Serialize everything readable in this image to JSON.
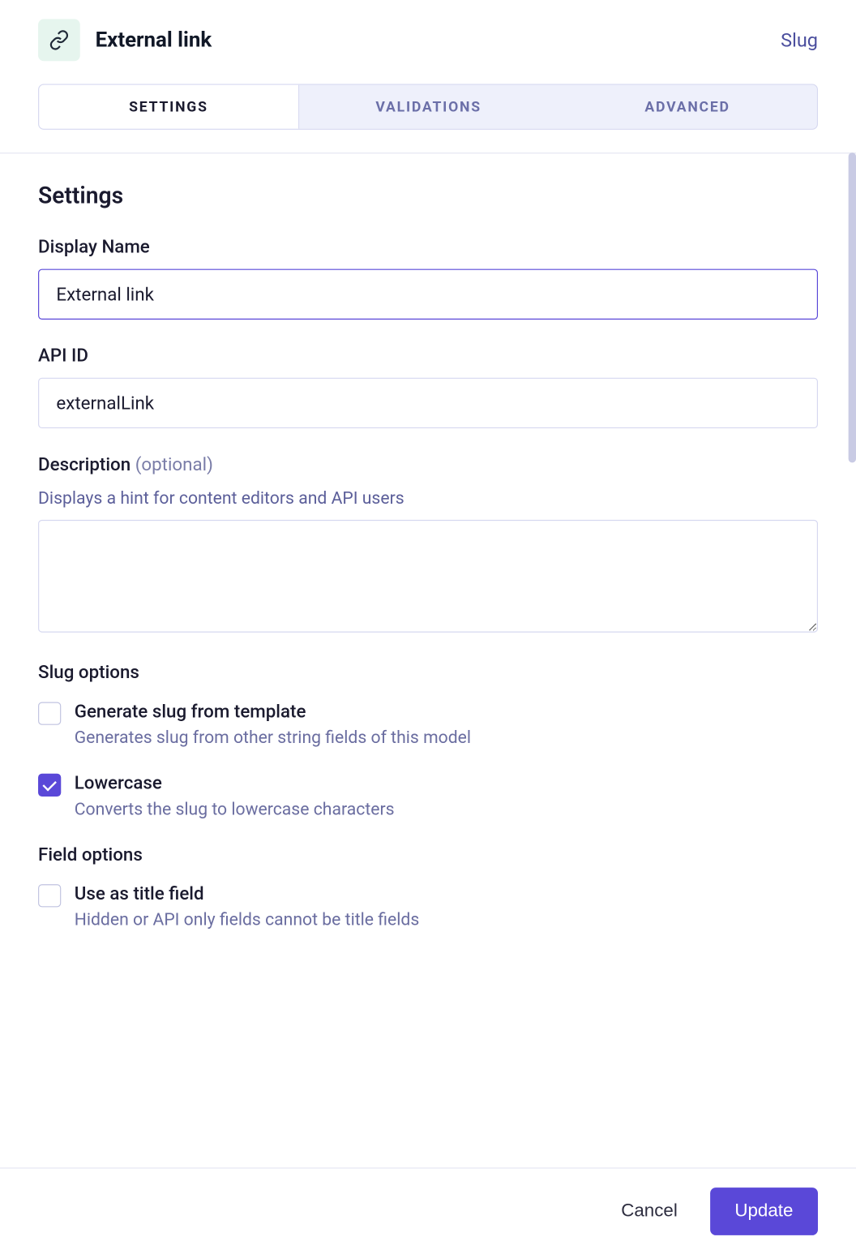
{
  "header": {
    "title": "External link",
    "field_type": "Slug"
  },
  "tabs": {
    "settings": "Settings",
    "validations": "Validations",
    "advanced": "Advanced"
  },
  "section": {
    "heading": "Settings"
  },
  "form": {
    "display_name": {
      "label": "Display Name",
      "value": "External link"
    },
    "api_id": {
      "label": "API ID",
      "value": "externalLink"
    },
    "description": {
      "label": "Description",
      "optional": "(optional)",
      "hint": "Displays a hint for content editors and API users",
      "value": ""
    }
  },
  "slug_options": {
    "heading": "Slug options",
    "generate": {
      "label": "Generate slug from template",
      "hint": "Generates slug from other string fields of this model",
      "checked": false
    },
    "lowercase": {
      "label": "Lowercase",
      "hint": "Converts the slug to lowercase characters",
      "checked": true
    }
  },
  "field_options": {
    "heading": "Field options",
    "title_field": {
      "label": "Use as title field",
      "hint": "Hidden or API only fields cannot be title fields",
      "checked": false
    }
  },
  "footer": {
    "cancel": "Cancel",
    "update": "Update"
  }
}
